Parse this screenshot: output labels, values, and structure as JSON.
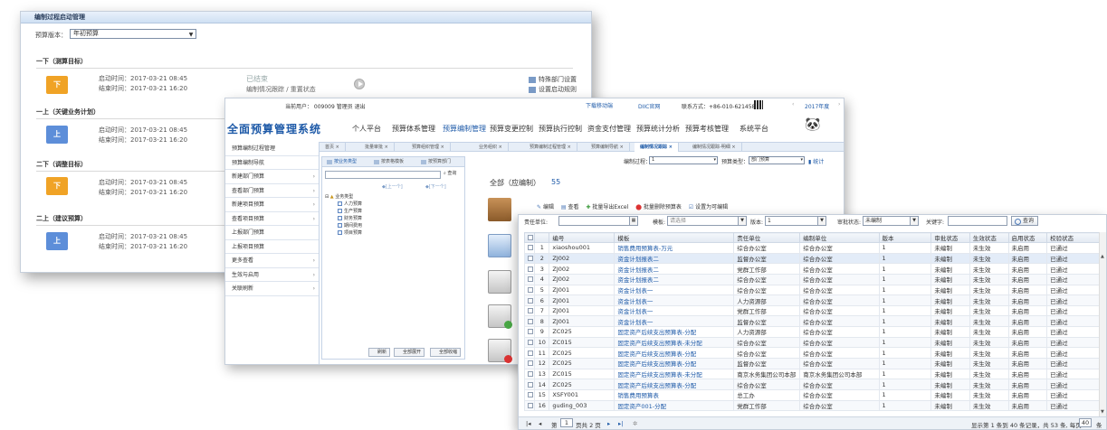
{
  "panel1": {
    "header": "编制过程启动管理",
    "version_label": "预算版本：",
    "version_value": "年初预算",
    "stages": [
      {
        "title": "一下（测算目标）",
        "box": "下",
        "start": "启动时间：2017-03-21  08:45",
        "end": "结束时间：2017-03-21  16:20",
        "status": "已结束",
        "status_sub": "编制情况跟踪 / 重置状态",
        "links": [
          "特殊部门设置",
          "设置启动规则"
        ]
      },
      {
        "title": "一上（关键业务计划）",
        "box": "上",
        "start": "启动时间：2017-03-21  08:45",
        "end": "结束时间：2017-03-21  16:20"
      },
      {
        "title": "二下（调整目标）",
        "box": "下",
        "start": "启动时间：2017-03-21  08:45",
        "end": "结束时间：2017-03-21  16:20"
      },
      {
        "title": "二上（建议预算）",
        "box": "上",
        "start": "启动时间：2017-03-21  08:45",
        "end": "结束时间：2017-03-21  16:20"
      }
    ]
  },
  "panel2": {
    "topbar": {
      "user": "当前用户：  009009 管理员  退出",
      "mobile": "下载移动端",
      "official": "DIIC官网",
      "contact": "联系方式：+86-010-62145868",
      "year": "2017年度"
    },
    "brand": "全面预算管理系统",
    "menu": [
      "个人平台",
      "预算体系管理",
      "预算编制管理",
      "预算变更控制",
      "预算执行控制",
      "资金支付管理",
      "预算统计分析",
      "预算考核管理",
      "系统平台"
    ],
    "tabs": [
      "首页",
      "批量审批",
      "预算组织管理",
      "业务组织",
      "预算编制过程管理",
      "预算编制导航",
      "编制情况跟踪",
      "编制情况跟踪-明细"
    ],
    "sidebar": [
      "预算编制过程管理",
      "预算编制导航",
      "新建部门预算",
      "查看部门预算",
      "新建项目预算",
      "查看项目预算",
      "上报部门预算",
      "上报项目预算",
      "更多查看",
      "生效与启用",
      "关联刷新"
    ],
    "tree": {
      "tabs": [
        "按业务类型",
        "按表格模板",
        "按预算部门"
      ],
      "search_btn": "查询",
      "prev": "[上一个]",
      "next": "[下一个]",
      "root": "业务类型",
      "children": [
        "人力预算",
        "生产预算",
        "财务预算",
        "期间费用",
        "项目预算"
      ],
      "buttons": [
        "刷新",
        "全部展开",
        "全部收缩"
      ]
    },
    "filter": {
      "process_label": "编制过程：",
      "process_value": "1",
      "type_label": "预算类型：",
      "type_value": "部门预算",
      "stats": "统计"
    },
    "summary_label": "全部（应编制）",
    "summary_count": "55",
    "toolbar": [
      "编辑",
      "查看",
      "批量导出Excel",
      "批量删除预算表",
      "设置为可编辑"
    ]
  },
  "panel3": {
    "filters": {
      "unit_label": "责任单位:",
      "template_label": "模板:",
      "template_value": "请选择",
      "version_label": "版本:",
      "version_value": "1",
      "approval_label": "审批状态:",
      "approval_value": "未编制",
      "keyword_label": "关键字:",
      "query_btn": "查询"
    },
    "columns": [
      "编号",
      "模板",
      "责任单位",
      "编制单位",
      "版本",
      "审批状态",
      "生效状态",
      "启用状态",
      "校验状态"
    ],
    "rows": [
      [
        "1",
        "xiaoshou001",
        "销售费用预算表-万元",
        "综合办公室",
        "综合办公室",
        "1",
        "未编制",
        "未生效",
        "未启用",
        "已通过"
      ],
      [
        "2",
        "ZJ002",
        "资金计划报表二",
        "监督办公室",
        "综合办公室",
        "1",
        "未编制",
        "未生效",
        "未启用",
        "已通过"
      ],
      [
        "3",
        "ZJ002",
        "资金计划报表二",
        "党群工作部",
        "综合办公室",
        "1",
        "未编制",
        "未生效",
        "未启用",
        "已通过"
      ],
      [
        "4",
        "ZJ002",
        "资金计划报表二",
        "综合办公室",
        "综合办公室",
        "1",
        "未编制",
        "未生效",
        "未启用",
        "已通过"
      ],
      [
        "5",
        "ZJ001",
        "资金计划表一",
        "综合办公室",
        "综合办公室",
        "1",
        "未编制",
        "未生效",
        "未启用",
        "已通过"
      ],
      [
        "6",
        "ZJ001",
        "资金计划表一",
        "人力资源部",
        "综合办公室",
        "1",
        "未编制",
        "未生效",
        "未启用",
        "已通过"
      ],
      [
        "7",
        "ZJ001",
        "资金计划表一",
        "党群工作部",
        "综合办公室",
        "1",
        "未编制",
        "未生效",
        "未启用",
        "已通过"
      ],
      [
        "8",
        "ZJ001",
        "资金计划表一",
        "监督办公室",
        "综合办公室",
        "1",
        "未编制",
        "未生效",
        "未启用",
        "已通过"
      ],
      [
        "9",
        "ZC025",
        "固定资产后续支出预算表-分配",
        "人力资源部",
        "综合办公室",
        "1",
        "未编制",
        "未生效",
        "未启用",
        "已通过"
      ],
      [
        "10",
        "ZC015",
        "固定资产后续支出预算表-未分配",
        "综合办公室",
        "综合办公室",
        "1",
        "未编制",
        "未生效",
        "未启用",
        "已通过"
      ],
      [
        "11",
        "ZC025",
        "固定资产后续支出预算表-分配",
        "综合办公室",
        "综合办公室",
        "1",
        "未编制",
        "未生效",
        "未启用",
        "已通过"
      ],
      [
        "12",
        "ZC025",
        "固定资产后续支出预算表-分配",
        "监督办公室",
        "综合办公室",
        "1",
        "未编制",
        "未生效",
        "未启用",
        "已通过"
      ],
      [
        "13",
        "ZC015",
        "固定资产后续支出预算表-未分配",
        "南京水务集团公司本部",
        "南京水务集团公司本部",
        "1",
        "未编制",
        "未生效",
        "未启用",
        "已通过"
      ],
      [
        "14",
        "ZC025",
        "固定资产后续支出预算表-分配",
        "综合办公室",
        "综合办公室",
        "1",
        "未编制",
        "未生效",
        "未启用",
        "已通过"
      ],
      [
        "15",
        "XSFY001",
        "销售费用预算表",
        "总工办",
        "综合办公室",
        "1",
        "未编制",
        "未生效",
        "未启用",
        "已通过"
      ],
      [
        "16",
        "guding_003",
        "固定资产001-分配",
        "党群工作部",
        "综合办公室",
        "1",
        "未编制",
        "未生效",
        "未启用",
        "已通过"
      ]
    ],
    "pager": {
      "page_label": "第",
      "page_value": "1",
      "page_total": "页共 2 页",
      "summary": "显示第 1 条到 40 条记录，共 53 条, 每页",
      "per_page": "40",
      "per_page_suffix": "条"
    }
  }
}
